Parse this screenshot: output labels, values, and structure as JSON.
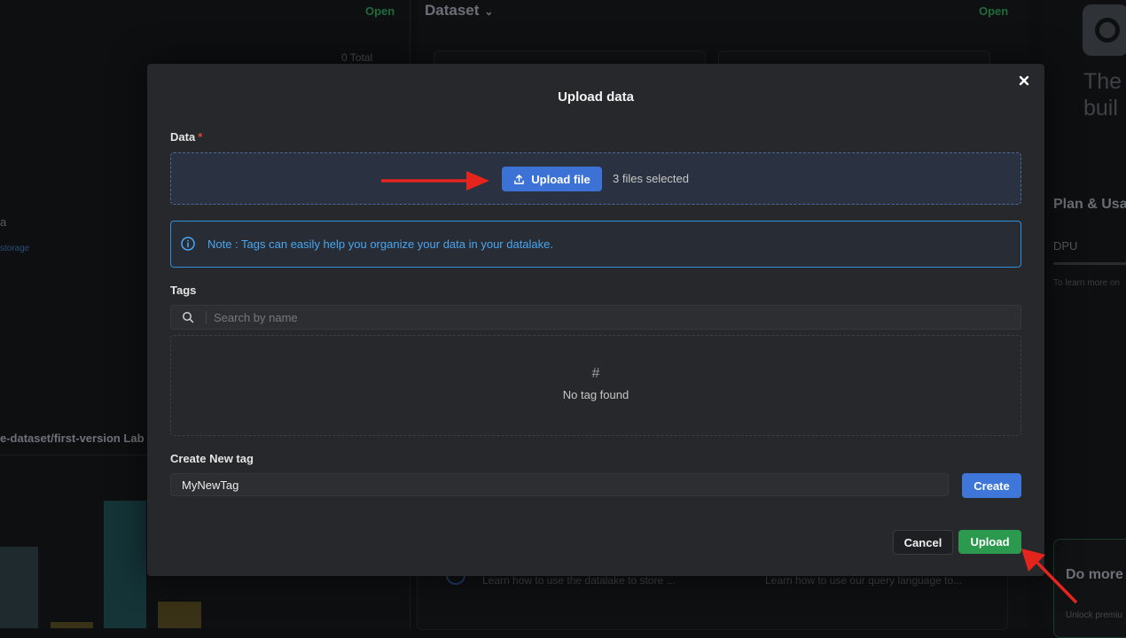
{
  "background": {
    "left_status": "Open",
    "left_total": "0 Total",
    "left_letter": "a",
    "left_storage": "storage",
    "left_dataset_path": "e-dataset/first-version Lab",
    "mid_title": "Dataset",
    "mid_status": "Open",
    "mid_learn_1": "Learn how to use the datalake to store ...",
    "mid_learn_2": "Learn how to use our query language to...",
    "right_promo_1": "The",
    "right_promo_2": "buil",
    "right_plan": "Plan & Usa",
    "right_dpu": "DPU",
    "right_learn": "To learn more on",
    "right_domore": "Do more",
    "right_unlock": "Unlock premiu",
    "colors": {
      "bar_teal": "#143438",
      "bar_olive": "#3a3216",
      "bar_slate": "#1f2a2e"
    }
  },
  "modal": {
    "title": "Upload data",
    "close_icon": "close-icon",
    "data_label": "Data",
    "required_mark": "*",
    "upload_button": "Upload file",
    "files_selected": "3 files selected",
    "note": "Note : Tags can easily help you organize your data in your datalake.",
    "tags_label": "Tags",
    "search_placeholder": "Search by name",
    "empty_icon": "#",
    "empty_text": "No tag found",
    "create_label": "Create New tag",
    "new_tag_value": "MyNewTag",
    "create_button": "Create",
    "cancel_button": "Cancel",
    "submit_button": "Upload"
  },
  "colors": {
    "primary": "#3c72d6",
    "success": "#2b9a4e",
    "info": "#4aa6f0",
    "required": "#e0453b",
    "annotation_arrow": "#e5251d"
  }
}
